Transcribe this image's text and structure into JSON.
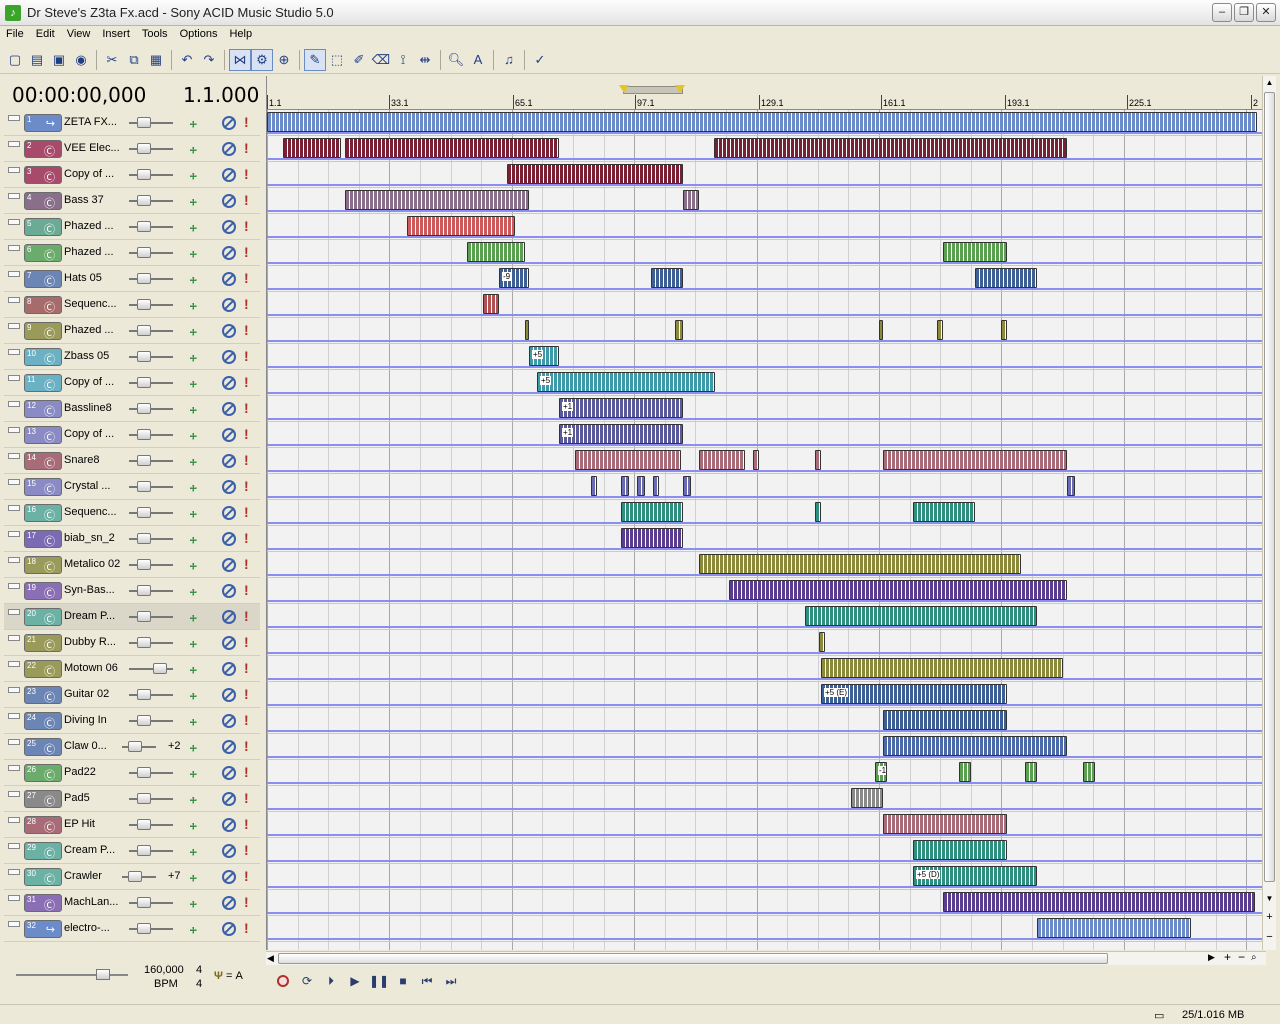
{
  "window": {
    "title": "Dr Steve's Z3ta Fx.acd - Sony ACID Music Studio 5.0",
    "icon": "acid-app-icon"
  },
  "window_buttons": [
    "minimize",
    "maximize",
    "close"
  ],
  "menu": [
    "File",
    "Edit",
    "View",
    "Insert",
    "Tools",
    "Options",
    "Help"
  ],
  "toolbar": [
    "new-icon",
    "open-icon",
    "save-icon",
    "render-icon",
    "cut-icon",
    "copy-icon",
    "paste-icon",
    "undo-icon",
    "redo-icon",
    "snap-icon",
    "auto-ripple-icon",
    "lock-icon",
    "draw-tool-icon",
    "selection-tool-icon",
    "paint-tool-icon",
    "erase-tool-icon",
    "envelope-tool-icon",
    "time-selection-icon",
    "zoom-tool-icon",
    "text-tool-icon",
    "metronome-icon",
    "properties-icon"
  ],
  "time": {
    "main": "00:00:00,000",
    "beat": "1.1.000"
  },
  "ruler_labels": [
    "1.1",
    "33.1",
    "65.1",
    "97.1",
    "129.1",
    "161.1",
    "193.1",
    "225.1",
    "2"
  ],
  "tracks": [
    {
      "num": "1",
      "name": "ZETA FX...",
      "color": "#6b8cc9",
      "glyph": "↪"
    },
    {
      "num": "2",
      "name": "VEE Elec...",
      "color": "#a84b6a",
      "glyph": "Ⓒ"
    },
    {
      "num": "3",
      "name": "Copy of ...",
      "color": "#a84b6a",
      "glyph": "Ⓒ"
    },
    {
      "num": "4",
      "name": "Bass 37",
      "color": "#8a6f8a",
      "glyph": "Ⓒ"
    },
    {
      "num": "5",
      "name": "Phazed ...",
      "color": "#6bab95",
      "glyph": "Ⓒ"
    },
    {
      "num": "6",
      "name": "Phazed ...",
      "color": "#6bab6b",
      "glyph": "Ⓒ"
    },
    {
      "num": "7",
      "name": "Hats 05",
      "color": "#6b85b4",
      "glyph": "Ⓒ"
    },
    {
      "num": "8",
      "name": "Sequenc...",
      "color": "#a86b6b",
      "glyph": "Ⓒ"
    },
    {
      "num": "9",
      "name": "Phazed ...",
      "color": "#9a9a5a",
      "glyph": "Ⓒ"
    },
    {
      "num": "10",
      "name": "Zbass 05",
      "color": "#6bb1c4",
      "glyph": "Ⓒ"
    },
    {
      "num": "11",
      "name": "Copy of ...",
      "color": "#6bb1c4",
      "glyph": "Ⓒ"
    },
    {
      "num": "12",
      "name": "Bassline8",
      "color": "#8a8ac4",
      "glyph": "Ⓒ"
    },
    {
      "num": "13",
      "name": "Copy of ...",
      "color": "#8a8ac4",
      "glyph": "Ⓒ"
    },
    {
      "num": "14",
      "name": "Snare8",
      "color": "#a86b78",
      "glyph": "Ⓒ"
    },
    {
      "num": "15",
      "name": "Crystal ...",
      "color": "#8a8ac4",
      "glyph": "Ⓒ"
    },
    {
      "num": "16",
      "name": "Sequenc...",
      "color": "#6bb1a4",
      "glyph": "Ⓒ"
    },
    {
      "num": "17",
      "name": "biab_sn_2",
      "color": "#7a6bb4",
      "glyph": "Ⓒ"
    },
    {
      "num": "18",
      "name": "Metalico 02",
      "color": "#9a9a5a",
      "glyph": "Ⓒ"
    },
    {
      "num": "19",
      "name": "Syn-Bas...",
      "color": "#8a6fb4",
      "glyph": "Ⓒ"
    },
    {
      "num": "20",
      "name": "Dream P...",
      "color": "#6bb1a4",
      "glyph": "Ⓒ"
    },
    {
      "num": "21",
      "name": "Dubby R...",
      "color": "#9a9a5a",
      "glyph": "Ⓒ"
    },
    {
      "num": "22",
      "name": "Motown 06",
      "color": "#9a9a5a",
      "glyph": "Ⓒ"
    },
    {
      "num": "23",
      "name": "Guitar 02",
      "color": "#6b85b4",
      "glyph": "Ⓒ"
    },
    {
      "num": "24",
      "name": "Diving In",
      "color": "#6b85b4",
      "glyph": "Ⓒ"
    },
    {
      "num": "25",
      "name": "Claw 0...",
      "color": "#6b85b4",
      "glyph": "Ⓒ",
      "pitch": "+2"
    },
    {
      "num": "26",
      "name": "Pad22",
      "color": "#6bab6b",
      "glyph": "Ⓒ"
    },
    {
      "num": "27",
      "name": "Pad5",
      "color": "#8a8a8a",
      "glyph": "Ⓒ"
    },
    {
      "num": "28",
      "name": "EP Hit",
      "color": "#a86b78",
      "glyph": "Ⓒ"
    },
    {
      "num": "29",
      "name": "Cream P...",
      "color": "#6bb1a4",
      "glyph": "Ⓒ"
    },
    {
      "num": "30",
      "name": "Crawler",
      "color": "#6bb1a4",
      "glyph": "Ⓒ",
      "pitch": "+7"
    },
    {
      "num": "31",
      "name": "MachLan...",
      "color": "#8a6fb4",
      "glyph": "Ⓒ"
    },
    {
      "num": "32",
      "name": "electro-...",
      "color": "#6b8cc9",
      "glyph": "↪"
    }
  ],
  "events": [
    {
      "lane": 0,
      "start": 0,
      "end": 990,
      "color": "#6b8cc9",
      "label": ""
    },
    {
      "lane": 1,
      "start": 16,
      "end": 74,
      "color": "#7a2035",
      "label": ""
    },
    {
      "lane": 1,
      "start": 78,
      "end": 292,
      "color": "#7a2035",
      "label": ""
    },
    {
      "lane": 1,
      "start": 447,
      "end": 800,
      "color": "#7a2035",
      "label": ""
    },
    {
      "lane": 2,
      "start": 240,
      "end": 416,
      "color": "#7a2035",
      "label": ""
    },
    {
      "lane": 3,
      "start": 78,
      "end": 262,
      "color": "#8a6f8a",
      "label": ""
    },
    {
      "lane": 3,
      "start": 416,
      "end": 432,
      "color": "#8a6f8a",
      "label": ""
    },
    {
      "lane": 4,
      "start": 140,
      "end": 248,
      "color": "#cc5a5a",
      "label": ""
    },
    {
      "lane": 5,
      "start": 200,
      "end": 258,
      "color": "#5aa050",
      "label": ""
    },
    {
      "lane": 5,
      "start": 676,
      "end": 740,
      "color": "#5aa050",
      "label": ""
    },
    {
      "lane": 6,
      "start": 232,
      "end": 262,
      "color": "#3e5f94",
      "label": "-9"
    },
    {
      "lane": 6,
      "start": 384,
      "end": 416,
      "color": "#3e5f94",
      "label": ""
    },
    {
      "lane": 6,
      "start": 708,
      "end": 770,
      "color": "#3e5f94",
      "label": ""
    },
    {
      "lane": 7,
      "start": 216,
      "end": 232,
      "color": "#b05050",
      "label": ""
    },
    {
      "lane": 8,
      "start": 258,
      "end": 262,
      "color": "#8a8a3a",
      "label": ""
    },
    {
      "lane": 8,
      "start": 408,
      "end": 416,
      "color": "#8a8a3a",
      "label": ""
    },
    {
      "lane": 8,
      "start": 612,
      "end": 616,
      "color": "#8a8a3a",
      "label": ""
    },
    {
      "lane": 8,
      "start": 670,
      "end": 676,
      "color": "#8a8a3a",
      "label": ""
    },
    {
      "lane": 8,
      "start": 734,
      "end": 740,
      "color": "#8a8a3a",
      "label": ""
    },
    {
      "lane": 9,
      "start": 262,
      "end": 292,
      "color": "#3d9aa8",
      "label": "+5"
    },
    {
      "lane": 10,
      "start": 270,
      "end": 448,
      "color": "#3d9aa8",
      "label": "+5"
    },
    {
      "lane": 11,
      "start": 292,
      "end": 416,
      "color": "#5a5a9a",
      "label": "+1"
    },
    {
      "lane": 12,
      "start": 292,
      "end": 416,
      "color": "#5a5a9a",
      "label": "+1"
    },
    {
      "lane": 13,
      "start": 308,
      "end": 414,
      "color": "#a86b78",
      "label": ""
    },
    {
      "lane": 13,
      "start": 432,
      "end": 478,
      "color": "#a86b78",
      "label": ""
    },
    {
      "lane": 13,
      "start": 486,
      "end": 492,
      "color": "#a86b78",
      "label": ""
    },
    {
      "lane": 13,
      "start": 548,
      "end": 554,
      "color": "#a86b78",
      "label": ""
    },
    {
      "lane": 13,
      "start": 616,
      "end": 800,
      "color": "#a86b78",
      "label": ""
    },
    {
      "lane": 14,
      "start": 324,
      "end": 330,
      "color": "#6b6bb4",
      "label": ""
    },
    {
      "lane": 14,
      "start": 354,
      "end": 362,
      "color": "#6b6bb4",
      "label": ""
    },
    {
      "lane": 14,
      "start": 370,
      "end": 378,
      "color": "#6b6bb4",
      "label": ""
    },
    {
      "lane": 14,
      "start": 386,
      "end": 392,
      "color": "#6b6bb4",
      "label": ""
    },
    {
      "lane": 14,
      "start": 416,
      "end": 424,
      "color": "#6b6bb4",
      "label": ""
    },
    {
      "lane": 14,
      "start": 800,
      "end": 808,
      "color": "#6b6bb4",
      "label": ""
    },
    {
      "lane": 15,
      "start": 354,
      "end": 416,
      "color": "#2f8f7f",
      "label": ""
    },
    {
      "lane": 15,
      "start": 548,
      "end": 554,
      "color": "#2f8f7f",
      "label": ""
    },
    {
      "lane": 15,
      "start": 646,
      "end": 708,
      "color": "#2f8f7f",
      "label": ""
    },
    {
      "lane": 16,
      "start": 354,
      "end": 416,
      "color": "#5a3d8e",
      "label": ""
    },
    {
      "lane": 17,
      "start": 432,
      "end": 754,
      "color": "#8a8a3a",
      "label": ""
    },
    {
      "lane": 18,
      "start": 462,
      "end": 800,
      "color": "#5a3d8e",
      "label": ""
    },
    {
      "lane": 19,
      "start": 538,
      "end": 770,
      "color": "#2f8f7f",
      "label": ""
    },
    {
      "lane": 20,
      "start": 552,
      "end": 558,
      "color": "#8a8a3a",
      "label": ""
    },
    {
      "lane": 21,
      "start": 554,
      "end": 796,
      "color": "#8a8a3a",
      "label": ""
    },
    {
      "lane": 22,
      "start": 554,
      "end": 740,
      "color": "#3e5f94",
      "label": "+5 (E)"
    },
    {
      "lane": 23,
      "start": 616,
      "end": 740,
      "color": "#3e5f94",
      "label": ""
    },
    {
      "lane": 24,
      "start": 616,
      "end": 800,
      "color": "#4d6aa8",
      "label": ""
    },
    {
      "lane": 25,
      "start": 608,
      "end": 620,
      "color": "#5aa050",
      "label": "-1"
    },
    {
      "lane": 25,
      "start": 692,
      "end": 704,
      "color": "#5aa050",
      "label": ""
    },
    {
      "lane": 25,
      "start": 758,
      "end": 770,
      "color": "#5aa050",
      "label": ""
    },
    {
      "lane": 25,
      "start": 816,
      "end": 828,
      "color": "#5aa050",
      "label": ""
    },
    {
      "lane": 26,
      "start": 584,
      "end": 616,
      "color": "#8a8a8a",
      "label": ""
    },
    {
      "lane": 27,
      "start": 616,
      "end": 740,
      "color": "#a86b78",
      "label": ""
    },
    {
      "lane": 28,
      "start": 646,
      "end": 740,
      "color": "#2f8f7f",
      "label": ""
    },
    {
      "lane": 29,
      "start": 646,
      "end": 770,
      "color": "#2f8f7f",
      "label": "+5 (D)"
    },
    {
      "lane": 30,
      "start": 676,
      "end": 988,
      "color": "#5a3d8e",
      "label": ""
    },
    {
      "lane": 31,
      "start": 770,
      "end": 924,
      "color": "#6b8cc9",
      "label": ""
    }
  ],
  "master": {
    "bpm": "160,000",
    "bpm_label": "BPM",
    "sig_top": "4",
    "sig_bottom": "4",
    "tuning": "= A"
  },
  "transport": [
    "record-icon",
    "loop-icon",
    "play-from-start-icon",
    "play-icon",
    "pause-icon",
    "stop-icon",
    "go-to-start-icon",
    "go-to-end-icon"
  ],
  "status": {
    "memory": "25/1.016 MB"
  }
}
